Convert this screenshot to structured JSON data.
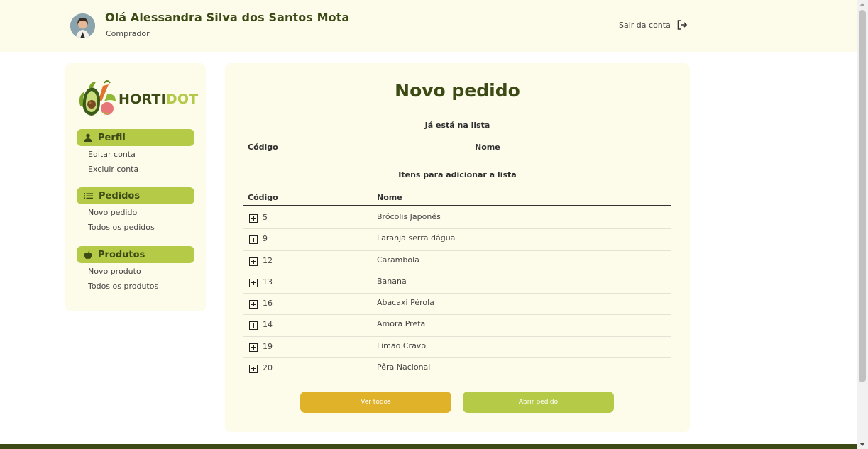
{
  "header": {
    "greeting": "Olá Alessandra Silva dos Santos Mota",
    "role": "Comprador",
    "logout_label": "Sair da conta",
    "avatar_icon": "user-avatar",
    "logout_icon": "logout-icon"
  },
  "brand": {
    "name_part1": "HORTI",
    "name_part2": "DOT",
    "logo_icon": "vegetables-logo"
  },
  "sidebar": {
    "groups": [
      {
        "label": "Perfil",
        "icon": "person-icon",
        "items": [
          "Editar conta",
          "Excluir conta"
        ]
      },
      {
        "label": "Pedidos",
        "icon": "list-icon",
        "items": [
          "Novo pedido",
          "Todos os pedidos"
        ]
      },
      {
        "label": "Produtos",
        "icon": "apple-icon",
        "items": [
          "Novo produto",
          "Todos os produtos"
        ]
      }
    ]
  },
  "main": {
    "title": "Novo pedido",
    "in_list": {
      "title": "Já está na lista",
      "columns": [
        "Código",
        "Nome"
      ],
      "rows": []
    },
    "to_add": {
      "title": "Itens para adicionar a lista",
      "columns": [
        "Código",
        "Nome"
      ],
      "rows": [
        {
          "code": "5",
          "name": "Brócolis Japonês"
        },
        {
          "code": "9",
          "name": "Laranja serra dágua"
        },
        {
          "code": "12",
          "name": "Carambola"
        },
        {
          "code": "13",
          "name": "Banana"
        },
        {
          "code": "16",
          "name": "Abacaxi Pérola"
        },
        {
          "code": "14",
          "name": "Amora Preta"
        },
        {
          "code": "19",
          "name": "Limão Cravo"
        },
        {
          "code": "20",
          "name": "Pêra Nacional"
        }
      ]
    },
    "buttons": {
      "view_all": "Ver todos",
      "open_order": "Abrir pedido"
    }
  },
  "colors": {
    "brand_dark": "#3c4a16",
    "brand_green": "#b5cb48",
    "accent_yellow": "#dfb229",
    "panel_bg": "#fdfbe9"
  }
}
